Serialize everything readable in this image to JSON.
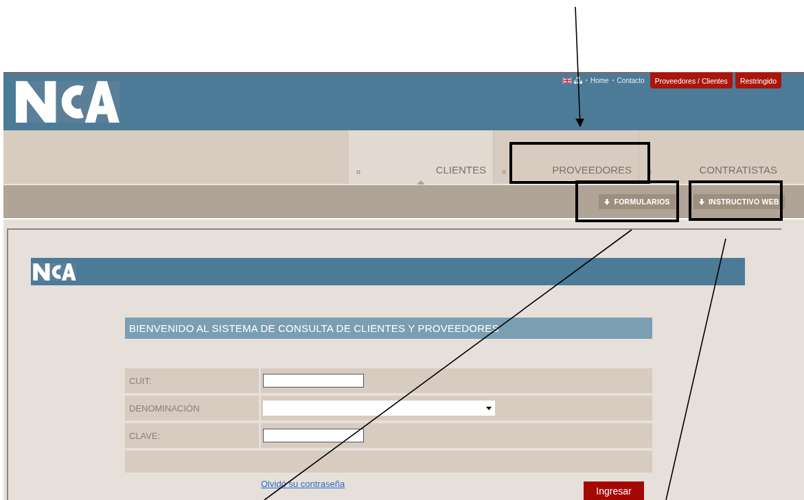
{
  "header": {
    "nav_links": [
      "Home",
      "Contacto"
    ],
    "top_buttons": [
      "Proveedores / Clientes",
      "Restringido"
    ]
  },
  "tabs": [
    {
      "label": "CLIENTES",
      "selected": true
    },
    {
      "label": "PROVEEDORES",
      "selected": false
    },
    {
      "label": "CONTRATISTAS",
      "selected": false
    }
  ],
  "sub_buttons": [
    "FORMULARIOS",
    "INSTRUCTIVO WEB"
  ],
  "login": {
    "title": "BIENVENIDO AL SISTEMA DE CONSULTA DE CLIENTES Y PROVEEDORES",
    "fields": [
      {
        "label": "CUIT:",
        "kind": "text"
      },
      {
        "label": "DENOMINACIÓN",
        "kind": "select"
      },
      {
        "label": "CLAVE:",
        "kind": "text"
      }
    ],
    "link": "Olvidó su contraseña",
    "submit": "Ingresar"
  }
}
